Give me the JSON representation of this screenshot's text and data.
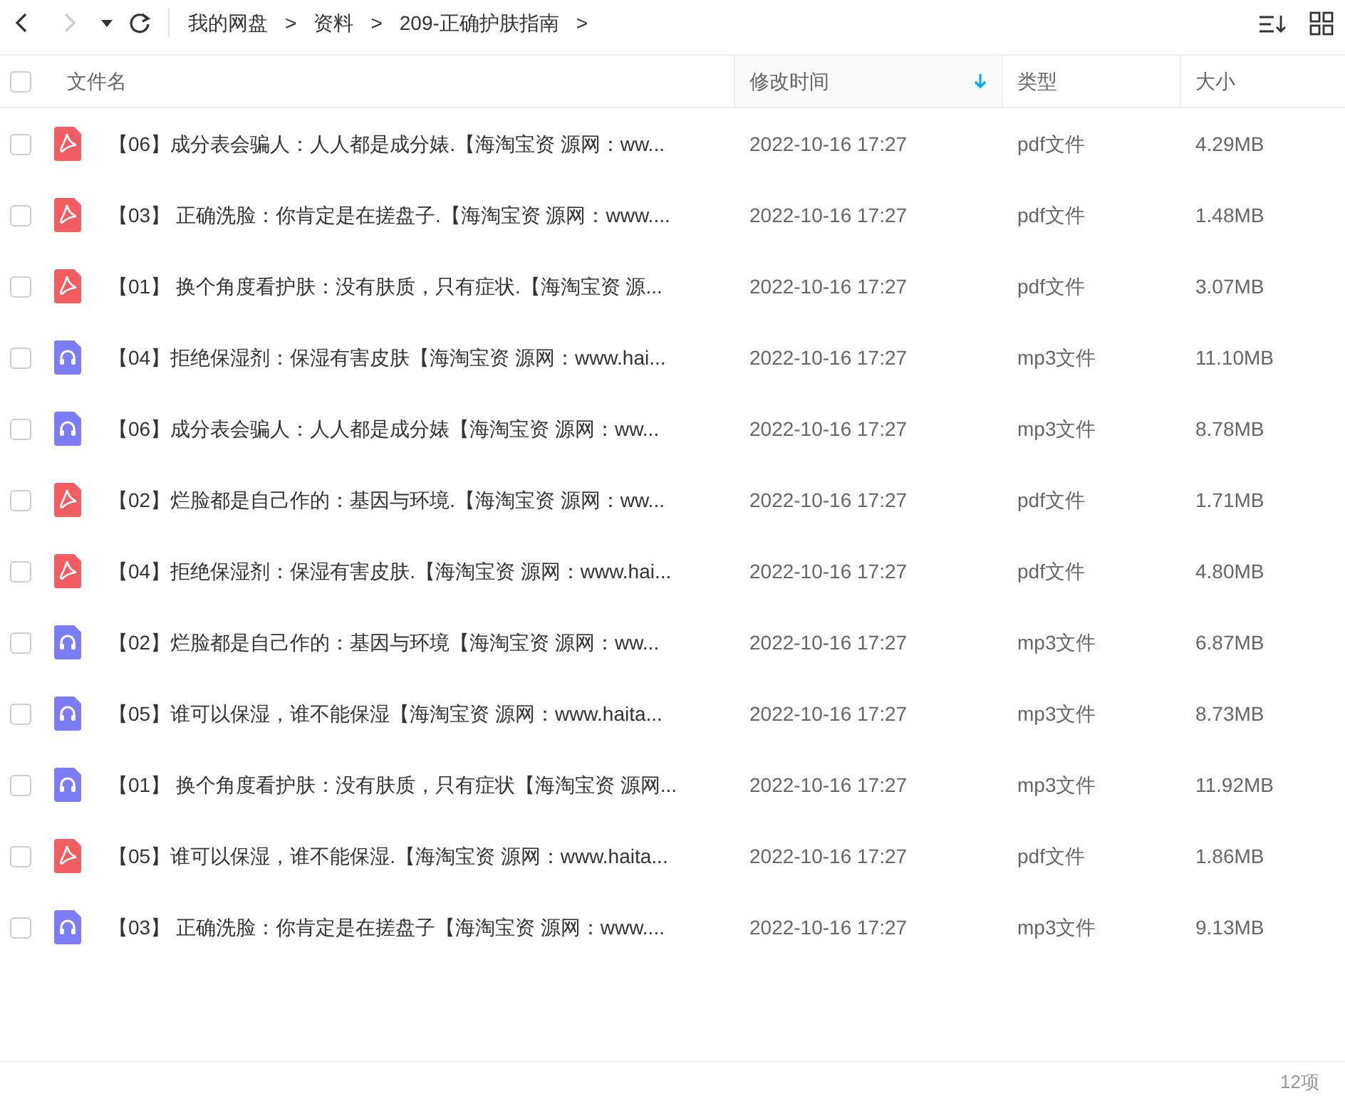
{
  "toolbar": {
    "back_disabled": false,
    "forward_disabled": true,
    "breadcrumb": [
      "我的网盘",
      "资料",
      "209-正确护肤指南"
    ],
    "separator": ">"
  },
  "table": {
    "select_all_checked": false,
    "columns": [
      {
        "label": "文件名",
        "sorted": false
      },
      {
        "label": "修改时间",
        "sorted": true
      },
      {
        "label": "类型",
        "sorted": false
      },
      {
        "label": "大小",
        "sorted": false
      }
    ],
    "rows": [
      {
        "kind": "pdf",
        "checked": false,
        "name": "【06】成分表会骗人：人人都是成分婊.【海淘宝资 源网：ww...",
        "modified": "2022-10-16 17:27",
        "type": "pdf文件",
        "size": "4.29MB"
      },
      {
        "kind": "pdf",
        "checked": false,
        "name": "【03】 正确洗脸：你肯定是在搓盘子.【海淘宝资 源网：www....",
        "modified": "2022-10-16 17:27",
        "type": "pdf文件",
        "size": "1.48MB"
      },
      {
        "kind": "pdf",
        "checked": false,
        "name": "【01】 换个角度看护肤：没有肤质，只有症状.【海淘宝资 源...",
        "modified": "2022-10-16 17:27",
        "type": "pdf文件",
        "size": "3.07MB"
      },
      {
        "kind": "mp3",
        "checked": false,
        "name": "【04】拒绝保湿剂：保湿有害皮肤【海淘宝资 源网：www.hai...",
        "modified": "2022-10-16 17:27",
        "type": "mp3文件",
        "size": "11.10MB"
      },
      {
        "kind": "mp3",
        "checked": false,
        "name": "【06】成分表会骗人：人人都是成分婊【海淘宝资 源网：ww...",
        "modified": "2022-10-16 17:27",
        "type": "mp3文件",
        "size": "8.78MB"
      },
      {
        "kind": "pdf",
        "checked": false,
        "name": "【02】烂脸都是自己作的：基因与环境.【海淘宝资 源网：ww...",
        "modified": "2022-10-16 17:27",
        "type": "pdf文件",
        "size": "1.71MB"
      },
      {
        "kind": "pdf",
        "checked": false,
        "name": "【04】拒绝保湿剂：保湿有害皮肤.【海淘宝资 源网：www.hai...",
        "modified": "2022-10-16 17:27",
        "type": "pdf文件",
        "size": "4.80MB"
      },
      {
        "kind": "mp3",
        "checked": false,
        "name": "【02】烂脸都是自己作的：基因与环境【海淘宝资 源网：ww...",
        "modified": "2022-10-16 17:27",
        "type": "mp3文件",
        "size": "6.87MB"
      },
      {
        "kind": "mp3",
        "checked": false,
        "name": "【05】谁可以保湿，谁不能保湿【海淘宝资 源网：www.haita...",
        "modified": "2022-10-16 17:27",
        "type": "mp3文件",
        "size": "8.73MB"
      },
      {
        "kind": "mp3",
        "checked": false,
        "name": "【01】 换个角度看护肤：没有肤质，只有症状【海淘宝资 源网...",
        "modified": "2022-10-16 17:27",
        "type": "mp3文件",
        "size": "11.92MB"
      },
      {
        "kind": "pdf",
        "checked": false,
        "name": "【05】谁可以保湿，谁不能保湿.【海淘宝资 源网：www.haita...",
        "modified": "2022-10-16 17:27",
        "type": "pdf文件",
        "size": "1.86MB"
      },
      {
        "kind": "mp3",
        "checked": false,
        "name": "【03】 正确洗脸：你肯定是在搓盘子【海淘宝资 源网：www....",
        "modified": "2022-10-16 17:27",
        "type": "mp3文件",
        "size": "9.13MB"
      }
    ]
  },
  "status_bar": {
    "count": "12项"
  }
}
